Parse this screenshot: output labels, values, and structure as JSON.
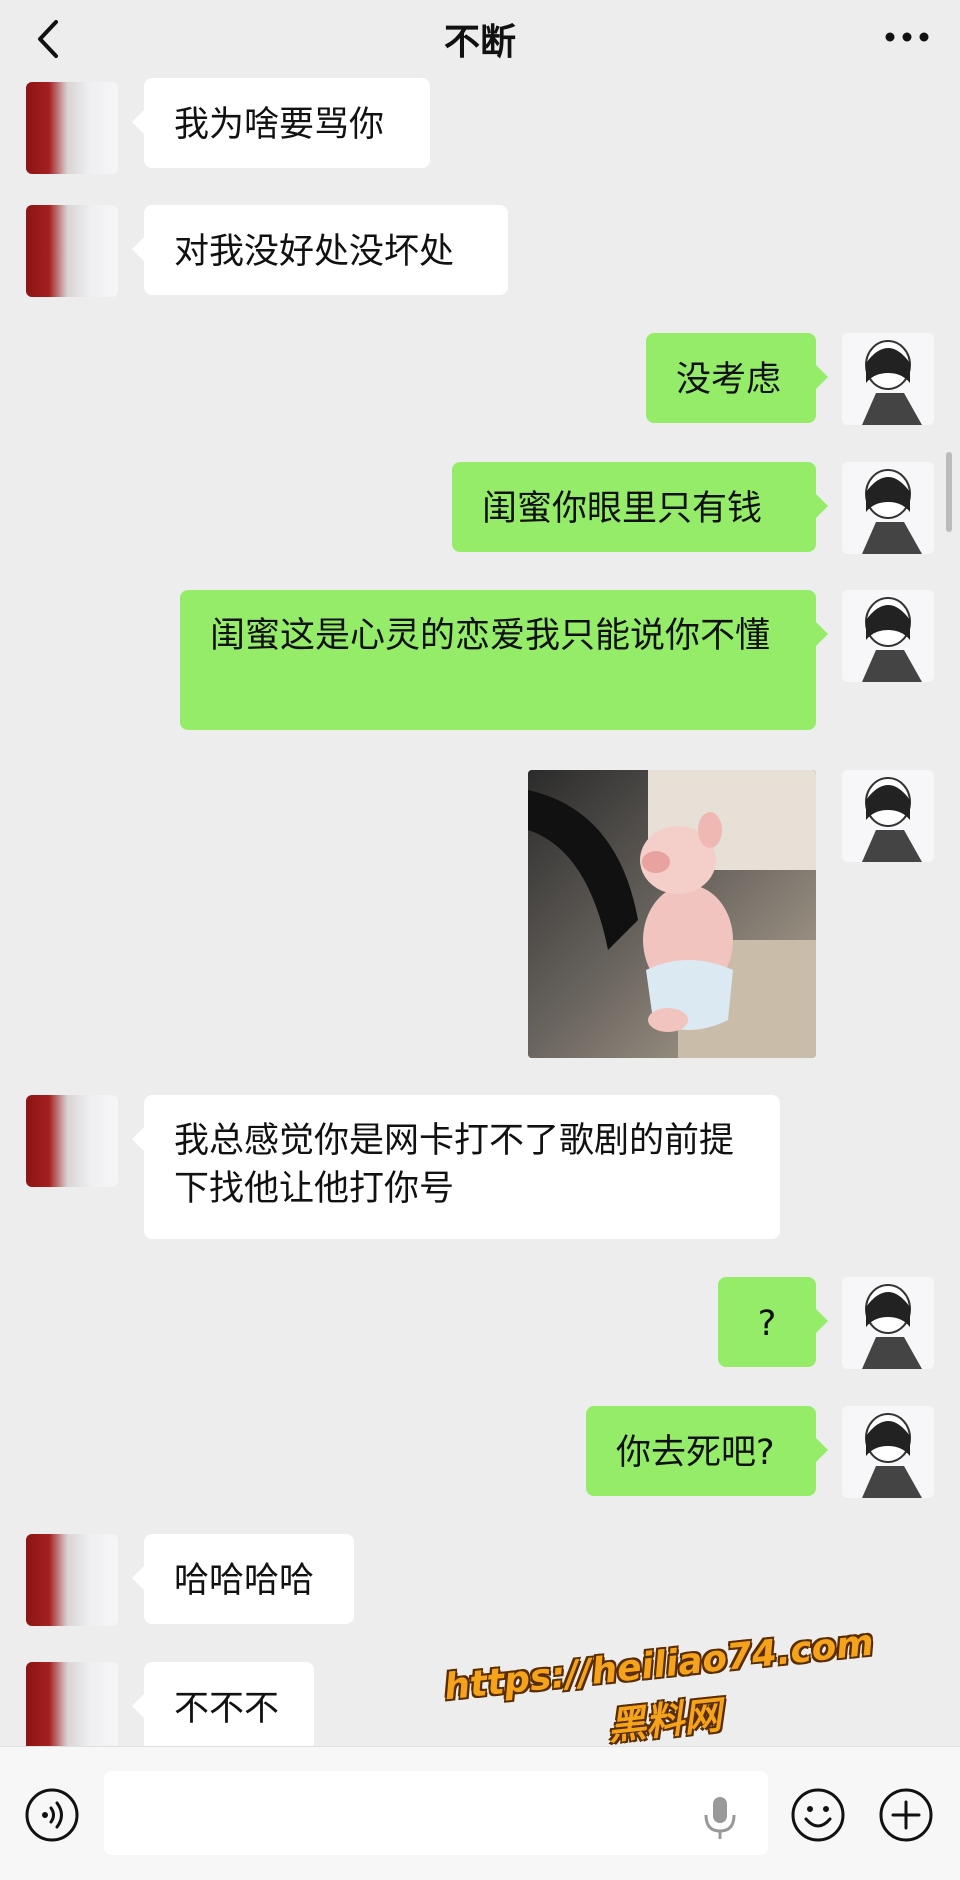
{
  "header": {
    "title": "不断",
    "back_icon": "chevron-left-icon",
    "more_icon": "ellipsis-icon"
  },
  "messages": [
    {
      "side": "left",
      "type": "text",
      "text": "我为啥要骂你"
    },
    {
      "side": "left",
      "type": "text",
      "text": "对我没好处没坏处"
    },
    {
      "side": "right",
      "type": "text",
      "text": "没考虑"
    },
    {
      "side": "right",
      "type": "text",
      "text": "闺蜜你眼里只有钱"
    },
    {
      "side": "right",
      "type": "text",
      "text": "闺蜜这是心灵的恋爱我只能说你不懂"
    },
    {
      "side": "right",
      "type": "image",
      "image": "pig-driving-car-image"
    },
    {
      "side": "left",
      "type": "text",
      "text": "我总感觉你是网卡打不了歌剧的前提下找他让他打你号"
    },
    {
      "side": "right",
      "type": "text",
      "text": "?"
    },
    {
      "side": "right",
      "type": "text",
      "text": "你去死吧?"
    },
    {
      "side": "left",
      "type": "text",
      "text": "哈哈哈哈"
    },
    {
      "side": "left",
      "type": "text",
      "text": "不不不"
    }
  ],
  "input_bar": {
    "placeholder": "",
    "voice_icon": "voice-icon",
    "mic_icon": "microphone-icon",
    "emoji_icon": "emoji-icon",
    "plus_icon": "plus-icon"
  },
  "watermark": {
    "url": "https://heiliao74.com",
    "name": "黑料网"
  },
  "colors": {
    "background": "#ededed",
    "my_bubble": "#95ec69",
    "other_bubble": "#ffffff",
    "watermark": "#f5a31a"
  }
}
